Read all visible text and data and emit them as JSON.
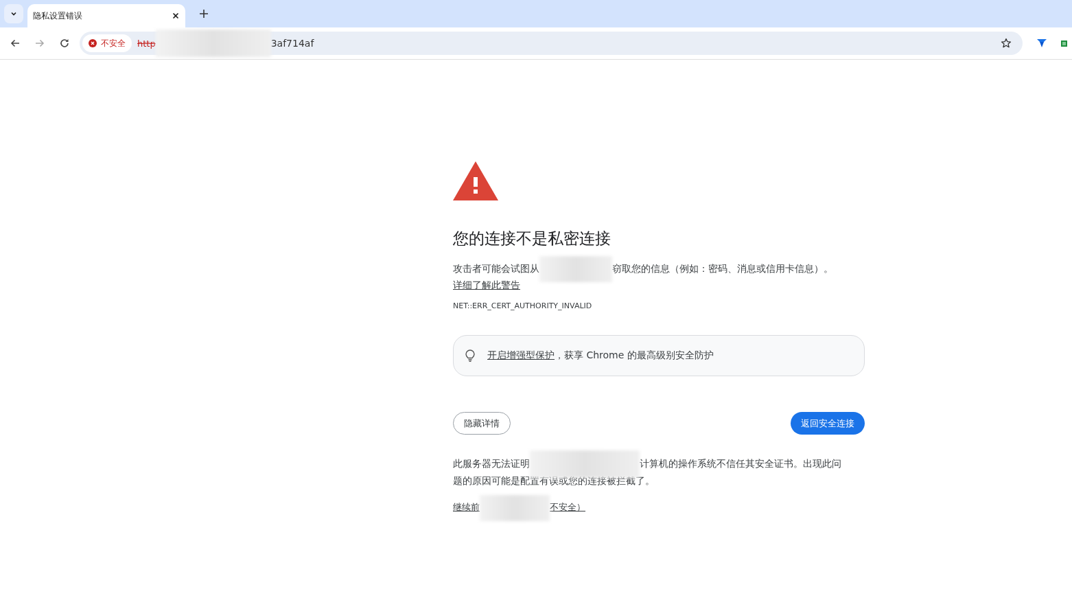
{
  "window": {
    "tab": {
      "title": "隐私设置错误",
      "selected": true
    }
  },
  "address_bar": {
    "security_label": "不安全",
    "scheme": "http",
    "url_tail": "3af714af"
  },
  "page": {
    "heading": "您的连接不是私密连接",
    "message": {
      "before": "攻击者可能会试图从",
      "after": "窃取您的信息（例如：密码、消息或信用卡信息）。"
    },
    "learn_more_link": "详细了解此警告",
    "error_code": "NET::ERR_CERT_AUTHORITY_INVALID",
    "tip": {
      "link": "开启增强型保护",
      "text": "，获享 Chrome 的最高级别安全防护"
    },
    "buttons": [
      {
        "label": "隐藏详情",
        "kind": "secondary"
      },
      {
        "label": "返回安全连接",
        "kind": "primary"
      }
    ],
    "details": {
      "before": "此服务器无法证明",
      "after": "计算机的操作系统不信任其安全证书。出现此问",
      "next_line": "题的原因可能是配置有误或您的连接被拦截了。"
    },
    "proceed_link": {
      "before": "继续前",
      "after": "不安全）"
    }
  }
}
